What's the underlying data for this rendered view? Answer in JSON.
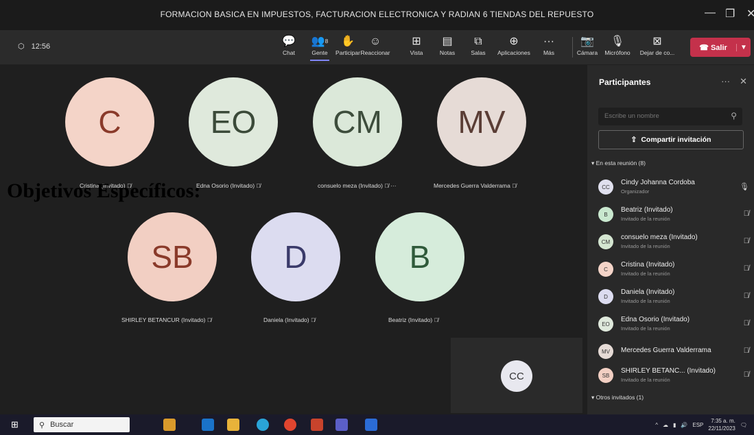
{
  "window": {
    "title": "FORMACION BASICA EN IMPUESTOS, FACTURACION ELECTRONICA Y RADIAN 6 TIENDAS DEL REPUESTO",
    "minimize": "—",
    "maximize": "❐",
    "close": "✕"
  },
  "toolbar": {
    "time": "12:56",
    "buttons": [
      {
        "label": "Chat",
        "icon": "chat-icon"
      },
      {
        "label": "Gente",
        "icon": "people-icon",
        "badge": "8"
      },
      {
        "label": "Participar",
        "icon": "hand-icon"
      },
      {
        "label": "Reaccionar",
        "icon": "emoji-icon"
      },
      {
        "label": "Vista",
        "icon": "view-icon"
      },
      {
        "label": "Notas",
        "icon": "notes-icon"
      },
      {
        "label": "Salas",
        "icon": "rooms-icon"
      },
      {
        "label": "Aplicaciones",
        "icon": "apps-icon"
      },
      {
        "label": "Más",
        "icon": "more-icon"
      },
      {
        "label": "Cámara",
        "icon": "camera-off-icon"
      },
      {
        "label": "Micrófono",
        "icon": "mic-icon"
      },
      {
        "label": "Dejar de co...",
        "icon": "stop-share-icon"
      }
    ],
    "leave_label": "Salir"
  },
  "overlay_heading": "Objetivos Específicos:",
  "tiles": [
    {
      "initials": "C",
      "name": "Cristina (Invitado)",
      "bg": "#f4d4c8",
      "fg": "#8a3a2a"
    },
    {
      "initials": "EO",
      "name": "Edna Osorio (Invitado)",
      "bg": "#dfe9dc",
      "fg": "#3b4a39"
    },
    {
      "initials": "CM",
      "name": "consuelo meza (Invitado)",
      "bg": "#dbe8d9",
      "fg": "#3d4d3c"
    },
    {
      "initials": "MV",
      "name": "Mercedes Guerra Valderrama",
      "bg": "#e6dbd6",
      "fg": "#5a3d35"
    },
    {
      "initials": "SB",
      "name": "SHIRLEY BETANCUR (Invitado)",
      "bg": "#f2cfc3",
      "fg": "#8a3a2a"
    },
    {
      "initials": "D",
      "name": "Daniela (Invitado)",
      "bg": "#dcdcf0",
      "fg": "#3a3a6a"
    },
    {
      "initials": "B",
      "name": "Beatriz (Invitado)",
      "bg": "#d6ecdb",
      "fg": "#2f5a3a"
    }
  ],
  "self_view": {
    "initials": "CC"
  },
  "panel": {
    "title": "Participantes",
    "search_placeholder": "Escribe un nombre",
    "invite_label": "Compartir invitación",
    "in_meeting_label": "▾ En esta reunión (8)",
    "others_label": "▾ Otros invitados (1)",
    "participants": [
      {
        "initials": "CC",
        "name": "Cindy Johanna Cordoba",
        "role": "Organizador",
        "bg": "#e0e0ee"
      },
      {
        "initials": "B",
        "name": "Beatriz (Invitado)",
        "role": "Invitado de la reunión",
        "bg": "#c9e8cf"
      },
      {
        "initials": "CM",
        "name": "consuelo meza (Invitado)",
        "role": "Invitado de la reunión",
        "bg": "#d4e6d1"
      },
      {
        "initials": "C",
        "name": "Cristina (Invitado)",
        "role": "Invitado de la reunión",
        "bg": "#f4d4c8"
      },
      {
        "initials": "D",
        "name": "Daniela (Invitado)",
        "role": "Invitado de la reunión",
        "bg": "#dcdcf0"
      },
      {
        "initials": "EO",
        "name": "Edna Osorio (Invitado)",
        "role": "Invitado de la reunión",
        "bg": "#dfe9dc"
      },
      {
        "initials": "MV",
        "name": "Mercedes Guerra Valderrama",
        "role": "",
        "bg": "#e6dbd6"
      },
      {
        "initials": "SB",
        "name": "SHIRLEY BETANC... (Invitado)",
        "role": "Invitado de la reunión",
        "bg": "#f2cfc3"
      }
    ]
  },
  "taskbar": {
    "search_label": "Buscar",
    "language": "ESP",
    "time": "7:35 a. m.",
    "date": "22/11/2023"
  },
  "colors": {
    "accent": "#7f85f5",
    "leave": "#c4314b",
    "panel_bg": "#292929"
  }
}
